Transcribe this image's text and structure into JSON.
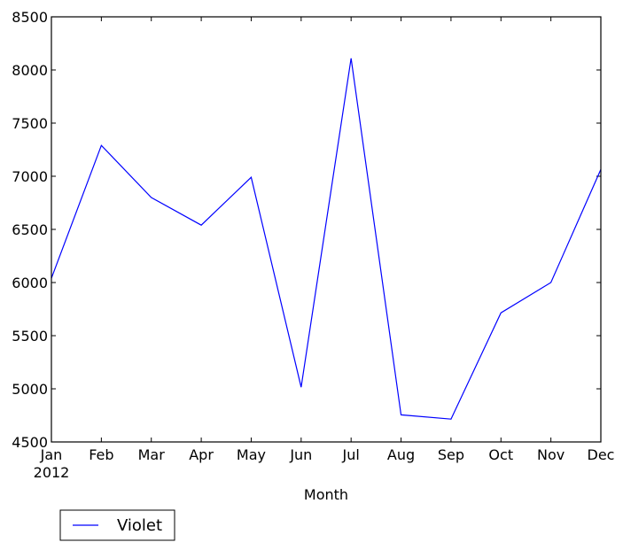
{
  "chart_data": {
    "type": "line",
    "title": "",
    "xlabel": "Month",
    "ylabel": "",
    "categories": [
      "Jan",
      "Feb",
      "Mar",
      "Apr",
      "May",
      "Jun",
      "Jul",
      "Aug",
      "Sep",
      "Oct",
      "Nov",
      "Dec"
    ],
    "x_sublabel": "2012",
    "series": [
      {
        "name": "Violet",
        "color": "#0000ff",
        "values": [
          6040,
          7290,
          6800,
          6540,
          6990,
          5015,
          8110,
          4755,
          4715,
          5715,
          6000,
          7065
        ]
      }
    ],
    "ylim": [
      4500,
      8500
    ],
    "yticks": [
      4500,
      5000,
      5500,
      6000,
      6500,
      7000,
      7500,
      8000,
      8500
    ],
    "grid": false,
    "legend": {
      "position": "below-left",
      "entries": [
        "Violet"
      ]
    }
  }
}
